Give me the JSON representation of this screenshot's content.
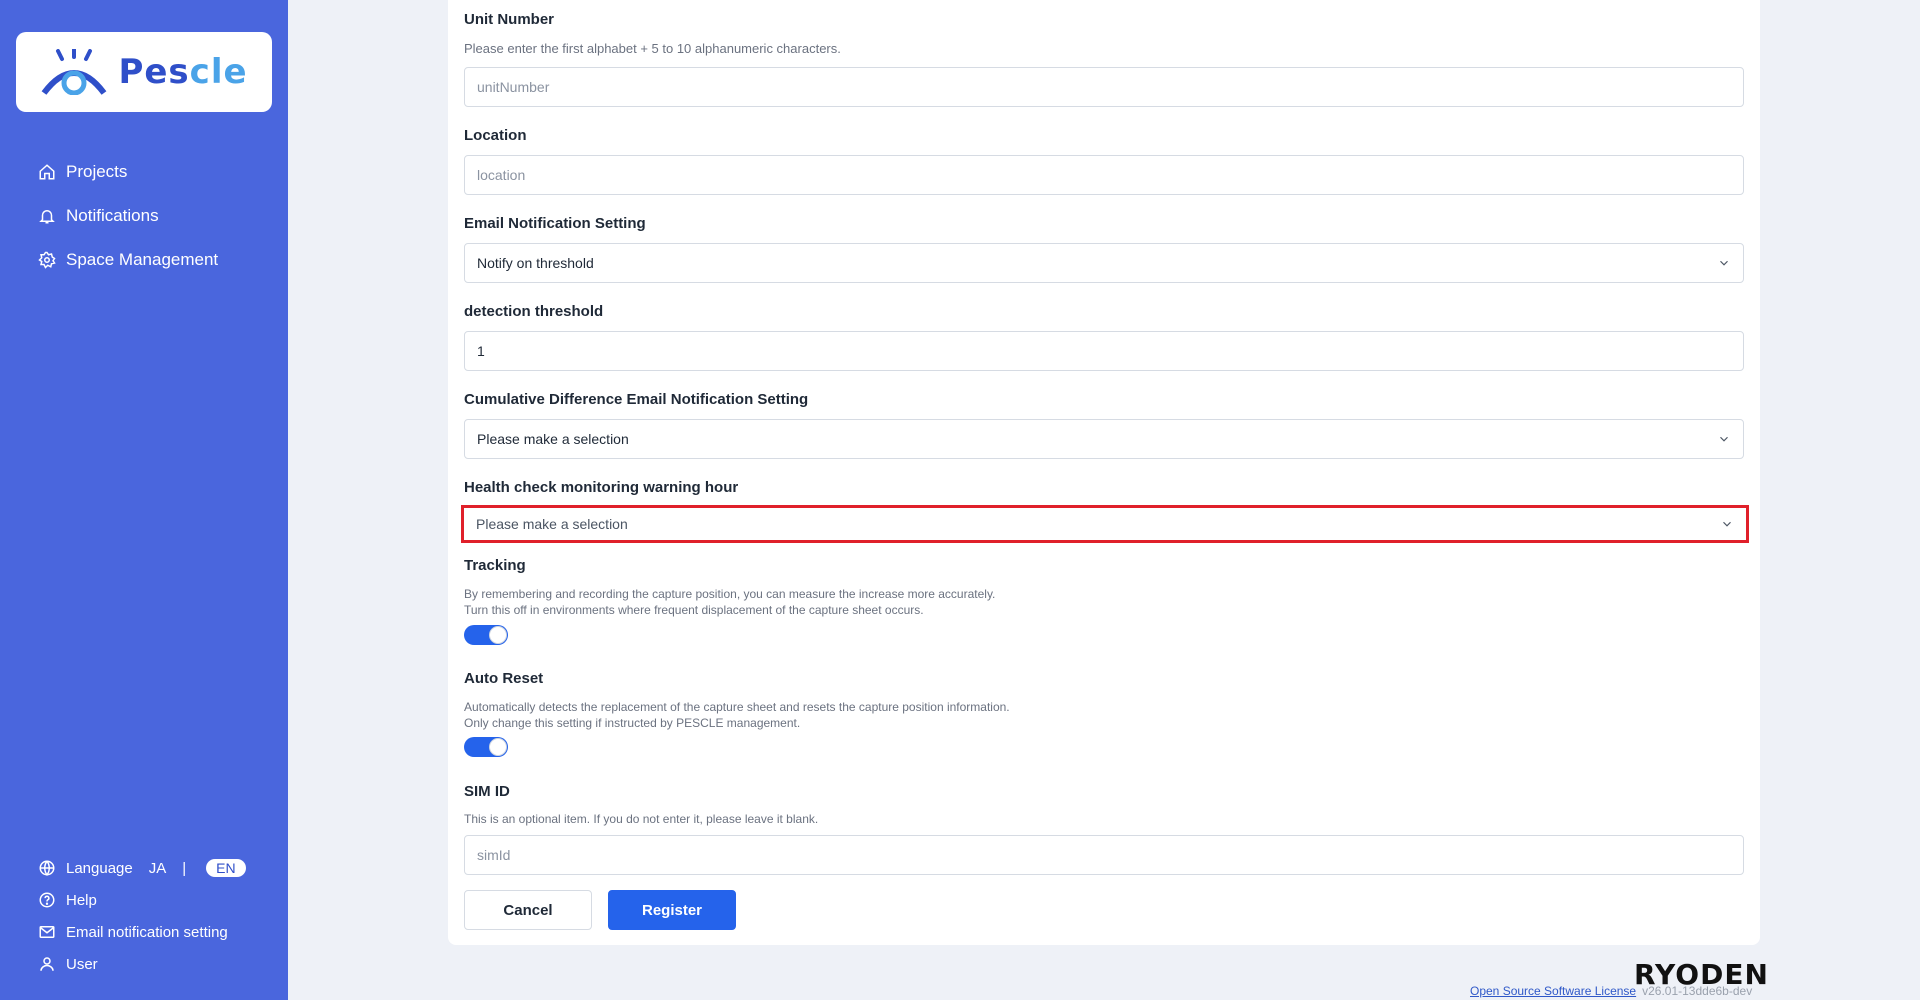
{
  "brand": {
    "logo_text_main": "Pes",
    "logo_text_accent": "cle"
  },
  "sidebar": {
    "nav": [
      {
        "label": "Projects",
        "icon": "home-icon"
      },
      {
        "label": "Notifications",
        "icon": "bell-icon"
      },
      {
        "label": "Space Management",
        "icon": "gear-icon"
      }
    ],
    "language_label": "Language",
    "language_options": {
      "ja": "JA",
      "separator": "|",
      "en": "EN"
    },
    "help_label": "Help",
    "email_setting_label": "Email notification setting",
    "user_label": "User"
  },
  "form": {
    "unit_number": {
      "label": "Unit Number",
      "description": "Please enter the first alphabet + 5 to 10 alphanumeric characters.",
      "placeholder": "unitNumber",
      "value": ""
    },
    "location": {
      "label": "Location",
      "placeholder": "location",
      "value": ""
    },
    "email_notification": {
      "label": "Email Notification Setting",
      "selected": "Notify on threshold"
    },
    "detection_threshold": {
      "label": "detection threshold",
      "value": "1"
    },
    "cumulative_email": {
      "label": "Cumulative Difference Email Notification Setting",
      "selected": "Please make a selection"
    },
    "health_check": {
      "label": "Health check monitoring warning hour",
      "selected": "Please make a selection"
    },
    "tracking": {
      "label": "Tracking",
      "description_1": "By remembering and recording the capture position, you can measure the increase more accurately.",
      "description_2": "Turn this off in environments where frequent displacement of the capture sheet occurs.",
      "enabled": true
    },
    "auto_reset": {
      "label": "Auto Reset",
      "description_1": "Automatically detects the replacement of the capture sheet and resets the capture position information.",
      "description_2": "Only change this setting if instructed by PESCLE management.",
      "enabled": true
    },
    "sim_id": {
      "label": "SIM ID",
      "description": "This is an optional item. If you do not enter it, please leave it blank.",
      "placeholder": "simId",
      "value": ""
    },
    "cancel_label": "Cancel",
    "register_label": "Register"
  },
  "footer": {
    "company": "RYODEN",
    "license_link": "Open Source Software License",
    "version": "v26.01-13dde6b-dev"
  },
  "colors": {
    "sidebar_bg": "#4a66dd",
    "primary": "#2563eb",
    "highlight_border": "#e0202a"
  }
}
